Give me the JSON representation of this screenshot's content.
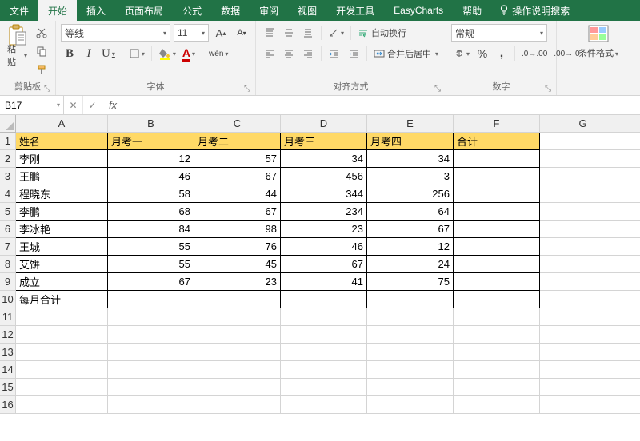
{
  "tabs": {
    "file": "文件",
    "home": "开始",
    "insert": "插入",
    "layout": "页面布局",
    "formulas": "公式",
    "data": "数据",
    "review": "审阅",
    "view": "视图",
    "dev": "开发工具",
    "easy": "EasyCharts",
    "help": "帮助",
    "tellme": "操作说明搜索"
  },
  "clipboard": {
    "paste": "粘贴",
    "label": "剪贴板"
  },
  "font": {
    "name": "等线",
    "size": "11",
    "label": "字体",
    "wen": "wén"
  },
  "align": {
    "label": "对齐方式",
    "wrap": "自动换行",
    "merge": "合并后居中"
  },
  "number": {
    "label": "数字",
    "format": "常规"
  },
  "styles": {
    "cf": "条件格式"
  },
  "namebox": "B17",
  "columns": [
    "A",
    "B",
    "C",
    "D",
    "E",
    "F",
    "G",
    ""
  ],
  "rows": [
    "1",
    "2",
    "3",
    "4",
    "5",
    "6",
    "7",
    "8",
    "9",
    "10",
    "11",
    "12",
    "13",
    "14",
    "15",
    "16"
  ],
  "sheet": {
    "headers": [
      "姓名",
      "月考一",
      "月考二",
      "月考三",
      "月考四",
      "合计"
    ],
    "data": [
      {
        "name": "李刚",
        "s": [
          12,
          57,
          34,
          34
        ]
      },
      {
        "name": "王鹏",
        "s": [
          46,
          67,
          456,
          3
        ]
      },
      {
        "name": "程晓东",
        "s": [
          58,
          44,
          344,
          256
        ]
      },
      {
        "name": "李鹏",
        "s": [
          68,
          67,
          234,
          64
        ]
      },
      {
        "name": "李冰艳",
        "s": [
          84,
          98,
          23,
          67
        ]
      },
      {
        "name": "王城",
        "s": [
          55,
          76,
          46,
          12
        ]
      },
      {
        "name": "艾饼",
        "s": [
          55,
          45,
          67,
          24
        ]
      },
      {
        "name": "成立",
        "s": [
          67,
          23,
          41,
          75
        ]
      }
    ],
    "footer": "每月合计"
  }
}
